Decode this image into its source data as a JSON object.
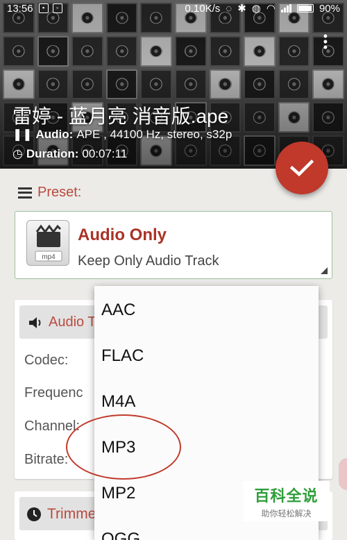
{
  "status_bar": {
    "time": "13:56",
    "network_speed": "0.10K/s",
    "battery": "90%"
  },
  "header": {
    "file_title": "雷婷 - 蓝月亮 消音版.ape",
    "audio_label": "Audio:",
    "audio_value": "APE , 44100 Hz, stereo, s32p",
    "duration_label": "Duration:",
    "duration_value": "00:07:11"
  },
  "preset": {
    "label": "Preset:",
    "name": "Audio Only",
    "description": "Keep Only Audio Track",
    "thumb_text": "mp4"
  },
  "audio_section": {
    "title": "Audio T",
    "fields": [
      "Codec:",
      "Frequenc",
      "Channel:",
      "Bitrate:"
    ]
  },
  "trim_section": {
    "title": "Trimme"
  },
  "dropdown": {
    "options": [
      "AAC",
      "FLAC",
      "M4A",
      "MP3",
      "MP2",
      "OGG"
    ],
    "highlighted": "MP3"
  },
  "watermark": {
    "title": "百科全说",
    "subtitle": "助你轻松解决"
  },
  "colors": {
    "accent": "#b94a3e",
    "fab": "#c0392b",
    "preset_border": "#9cc09a",
    "watermark_green": "#2e9e3a"
  }
}
